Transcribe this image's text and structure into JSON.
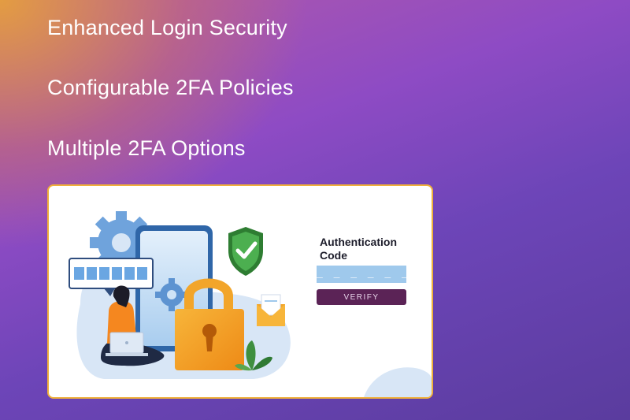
{
  "features": [
    "Enhanced Login Security",
    "Configurable 2FA Policies",
    "Multiple 2FA Options"
  ],
  "illustration": {
    "password_mask": "******",
    "auth_title": "Authentication Code",
    "code_placeholder": "_ _ _ _ _ _",
    "verify_label": "VERIFY",
    "icons": [
      "gear-icon",
      "smartphone-icon",
      "shield-check-icon",
      "padlock-icon",
      "envelope-icon",
      "laptop-icon",
      "plant-icon"
    ]
  },
  "colors": {
    "card_border": "#f0b03a",
    "verify_button": "#5b2356",
    "code_field": "#9fc9ec",
    "shield": "#3a9a3a",
    "padlock": "#f39c1f"
  }
}
